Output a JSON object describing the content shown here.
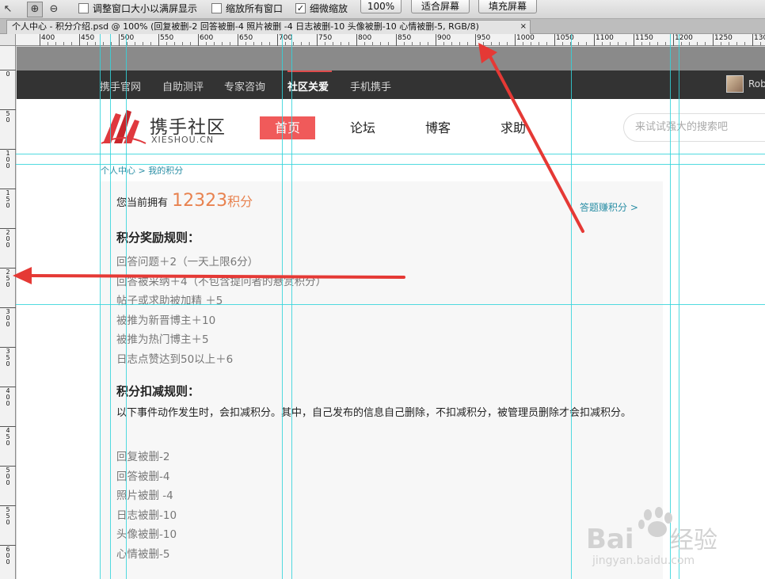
{
  "ps": {
    "options": {
      "resize_windows": "调整窗口大小以满屏显示",
      "zoom_all_windows": "缩放所有窗口",
      "scrubby_zoom": "细微缩放",
      "zoom_value": "100%",
      "fit_screen": "适合屏幕",
      "fill_screen": "填充屏幕"
    },
    "doc_title": "个人中心 - 积分介绍.psd @ 100% (回复被删-2 回答被删-4 照片被删 -4 日志被删-10 头像被删-10 心情被删-5, RGB/8)",
    "close": "×",
    "ruler_top": [
      "400",
      "450",
      "500",
      "550",
      "600",
      "650",
      "700",
      "750",
      "800",
      "850",
      "900",
      "950",
      "1000",
      "1050",
      "1100",
      "1150",
      "1200",
      "1250",
      "1300"
    ],
    "ruler_left": [
      "0",
      "50",
      "100",
      "150",
      "200",
      "250",
      "300",
      "350",
      "400",
      "450",
      "500",
      "550",
      "600"
    ]
  },
  "site": {
    "topnav": [
      "携手官网",
      "自助测评",
      "专家咨询",
      "社区关爱",
      "手机携手"
    ],
    "topnav_active_index": 3,
    "user_name": "Rob",
    "logo_cn": "携手社区",
    "logo_en": "XIESHOU.CN",
    "mainnav": [
      "首页",
      "论坛",
      "博客",
      "求助"
    ],
    "mainnav_active_index": 0,
    "search_placeholder": "来试试强大的搜索吧",
    "breadcrumb": "个人中心 > 我的积分",
    "balance_prefix": "您当前拥有",
    "balance_value": "12323",
    "balance_unit": "积分",
    "earn_link": "答题赚积分 >",
    "reward_title": "积分奖励规则：",
    "reward_rules": [
      "回答问题＋2（一天上限6分）",
      "回答被采纳＋4（不包含提问者的悬赏积分）",
      "帖子或求助被加精 ＋5",
      "被推为新晋博主＋10",
      "被推为热门博主＋5",
      "日志点赞达到50以上＋6"
    ],
    "deduct_title": "积分扣减规则：",
    "deduct_desc": "以下事件动作发生时，会扣减积分。其中，自己发布的信息自己删除，不扣减积分，被管理员删除才会扣减积分。",
    "deduct_rules": [
      "回复被删-2",
      "回答被删-4",
      "照片被删 -4",
      "日志被删-10",
      "头像被删-10",
      "心情被删-5"
    ]
  },
  "watermark": {
    "brand": "Bai",
    "brand_tail": "经验",
    "url": "jingyan.baidu.com"
  },
  "colors": {
    "accent_red": "#f05a5a",
    "points_orange": "#e8824f",
    "link_teal": "#2a8ea5",
    "guide_cyan": "#33d3da",
    "arrow_red": "#e53935"
  }
}
